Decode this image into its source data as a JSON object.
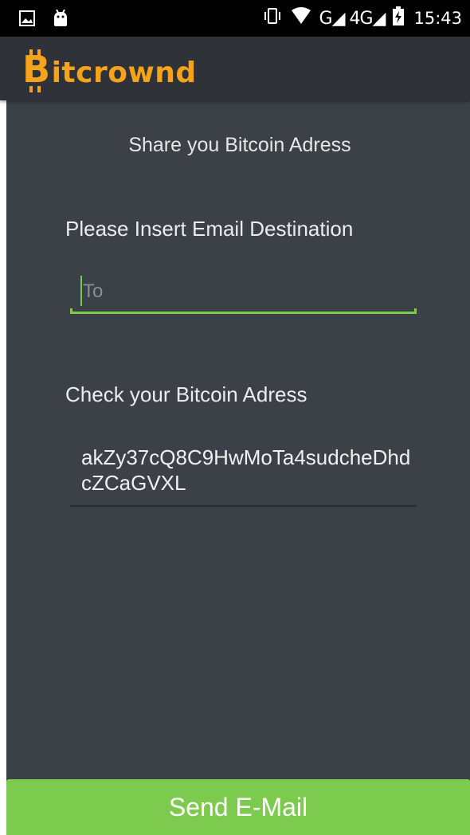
{
  "status_bar": {
    "network": "G◢ 4G◢",
    "time": "15:43",
    "icons": [
      "gallery-icon",
      "android-icon",
      "vibrate-icon",
      "wifi-icon",
      "signal-icon",
      "battery-charging-icon"
    ]
  },
  "app_bar": {
    "logo_initial": "B",
    "logo_rest": "itcrownd",
    "brand_color": "#f5a31a"
  },
  "main": {
    "title": "Share you Bitcoin Adress",
    "email_label": "Please Insert Email Destination",
    "email_input": {
      "value": "",
      "placeholder": "To"
    },
    "address_label": "Check your Bitcoin Adress",
    "address_value": "akZy37cQ8C9HwMoTa4sudcheDhdcZCaGVXL"
  },
  "footer": {
    "send_label": "Send E-Mail",
    "accent": "#7ccb4f"
  }
}
